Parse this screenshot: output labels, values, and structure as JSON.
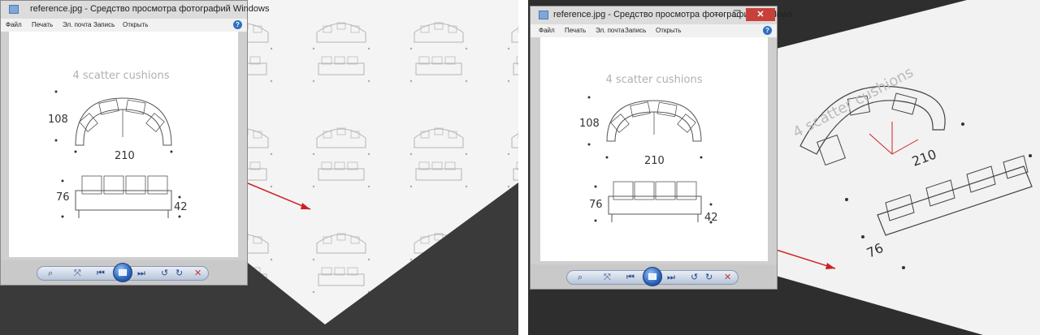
{
  "viewer": {
    "title": "reference.jpg - Средство просмотра фотографий Windows",
    "menu": [
      "Файл",
      "Печать",
      "Эл. почта",
      "Запись",
      "Открыть"
    ],
    "help_icon": "?",
    "close_icon": "✕",
    "minimize_icon": "—",
    "maximize_icon": "❐",
    "toolbar": {
      "zoom_icon": "⌕",
      "fit_icon": "⤧",
      "previous_icon": "⏮",
      "next_icon": "⏭",
      "rotate_left_icon": "↺",
      "rotate_right_icon": "↻",
      "delete_icon": "✕"
    }
  },
  "sketch": {
    "heading": "4 scatter cushions",
    "depth": "108",
    "width": "210",
    "height": "76",
    "seat_height": "42"
  },
  "colors": {
    "arrow": "#cc2222",
    "close_button": "#c8403a",
    "dark_background": "#2e2e2e"
  }
}
